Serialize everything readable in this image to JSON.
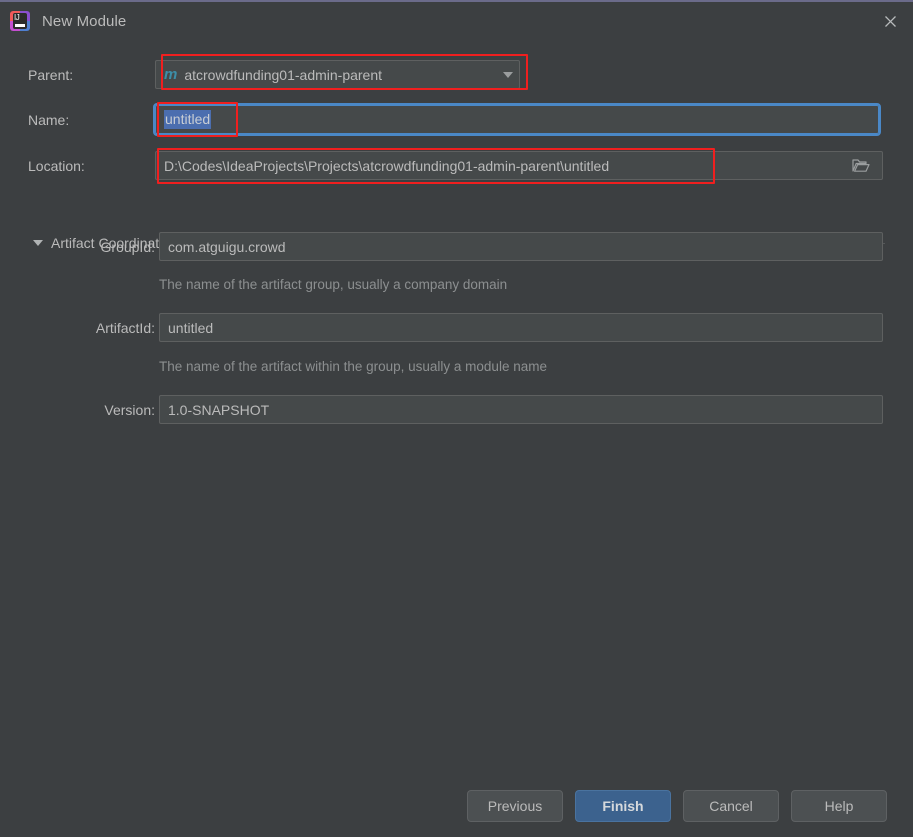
{
  "window": {
    "title": "New Module",
    "app_icon": "intellij-idea-icon",
    "close_icon": "close-icon",
    "accent_border": "#6b6b8a",
    "background": "#3c3f41"
  },
  "form": {
    "parent": {
      "label": "Parent:",
      "value": "atcrowdfunding01-admin-parent",
      "icon": "maven-icon",
      "icon_glyph": "m",
      "arrow_icon": "chevron-down-icon",
      "highlighted": true
    },
    "name": {
      "label": "Name:",
      "value": "untitled",
      "selected": true,
      "focused": true,
      "highlighted": true
    },
    "location": {
      "label": "Location:",
      "value": "D:\\Codes\\IdeaProjects\\Projects\\atcrowdfunding01-admin-parent\\untitled",
      "browse_icon": "folder-icon",
      "highlighted": true
    }
  },
  "artifact_coordinates": {
    "section_label": "Artifact Coordinates",
    "expanded": true,
    "toggle_icon": "triangle-down-icon",
    "fields": [
      {
        "label": "GroupId:",
        "value": "com.atguigu.crowd",
        "hint": "The name of the artifact group, usually a company domain"
      },
      {
        "label": "ArtifactId:",
        "value": "untitled",
        "hint": "The name of the artifact within the group, usually a module name"
      },
      {
        "label": "Version:",
        "value": "1.0-SNAPSHOT",
        "hint": ""
      }
    ]
  },
  "footer": {
    "buttons": [
      {
        "label": "Previous",
        "primary": false
      },
      {
        "label": "Finish",
        "primary": true
      },
      {
        "label": "Cancel",
        "primary": false
      },
      {
        "label": "Help",
        "primary": false
      }
    ]
  },
  "annotations": {
    "color": "#f01f1f",
    "count": 3
  }
}
